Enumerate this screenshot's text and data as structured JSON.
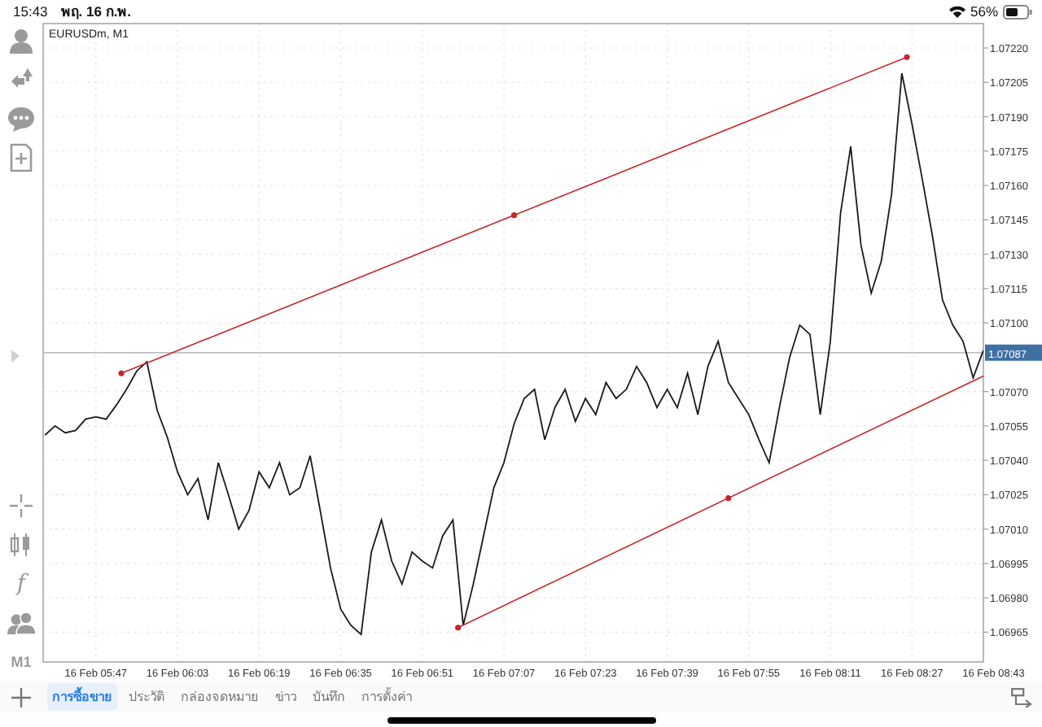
{
  "status_bar": {
    "time": "15:43",
    "date": "พฤ. 16 ก.พ.",
    "battery": "56%"
  },
  "toolbar": {
    "function_glyph": "f",
    "timeframe": "M1"
  },
  "chart": {
    "title": "EURUSDm, M1",
    "chart_data": {
      "type": "line",
      "grid": true,
      "categories": [
        null,
        null,
        null,
        null,
        null,
        "16 Feb 05:47",
        null,
        null,
        null,
        null,
        null,
        null,
        null,
        "16 Feb 06:03",
        null,
        null,
        null,
        null,
        null,
        null,
        null,
        "16 Feb 06:19",
        null,
        null,
        null,
        null,
        null,
        null,
        null,
        "16 Feb 06:35",
        null,
        null,
        null,
        null,
        null,
        null,
        null,
        "16 Feb 06:51",
        null,
        null,
        null,
        null,
        null,
        null,
        null,
        "16 Feb 07:07",
        null,
        null,
        null,
        null,
        null,
        null,
        null,
        "16 Feb 07:23",
        null,
        null,
        null,
        null,
        null,
        null,
        null,
        "16 Feb 07:39",
        null,
        null,
        null,
        null,
        null,
        null,
        null,
        "16 Feb 07:55",
        null,
        null,
        null,
        null,
        null,
        null,
        null,
        "16 Feb 08:11",
        null,
        null,
        null,
        null,
        null,
        null,
        null,
        "16 Feb 08:27",
        null,
        null,
        null,
        null,
        null,
        null,
        null,
        "16 Feb 08:43"
      ],
      "series": [
        {
          "color": "#1a1a1a",
          "values": [
            1.07051,
            1.07055,
            1.07052,
            1.07053,
            1.07058,
            1.07059,
            1.07058,
            1.07064,
            1.07071,
            1.07079,
            1.07083,
            1.07062,
            1.0705,
            1.07035,
            1.07025,
            1.07032,
            1.07014,
            1.07039,
            1.07025,
            1.0701,
            1.07018,
            1.07035,
            1.07028,
            1.07039,
            1.07025,
            1.07028,
            1.07042,
            1.07018,
            1.06993,
            1.06975,
            1.06968,
            1.06964,
            1.07,
            1.07014,
            1.06996,
            1.06986,
            1.07,
            1.06996,
            1.06993,
            1.07007,
            1.07014,
            1.06968,
            1.06986,
            1.07007,
            1.07028,
            1.07039,
            1.07056,
            1.07067,
            1.07071,
            1.07049,
            1.07063,
            1.07071,
            1.07057,
            1.07067,
            1.0706,
            1.07074,
            1.07067,
            1.07071,
            1.07081,
            1.07074,
            1.07063,
            1.07071,
            1.07063,
            1.07078,
            1.0706,
            1.07081,
            1.07092,
            1.07074,
            1.07067,
            1.0706,
            1.07049,
            1.07039,
            1.07063,
            1.07085,
            1.07099,
            1.07095,
            1.0706,
            1.07092,
            1.07148,
            1.07177,
            1.07134,
            1.07113,
            1.07127,
            1.07156,
            1.07209,
            1.07187,
            1.07163,
            1.07138,
            1.0711,
            1.07099,
            1.07092,
            1.07076,
            1.07088,
            null
          ]
        }
      ],
      "ylim": [
        1.06952,
        1.07231
      ],
      "yticks": [
        {
          "value": 1.0722,
          "label": "1.07220"
        },
        {
          "value": 1.07205,
          "label": "1.07205"
        },
        {
          "value": 1.0719,
          "label": "1.07190"
        },
        {
          "value": 1.07175,
          "label": "1.07175"
        },
        {
          "value": 1.0716,
          "label": "1.07160"
        },
        {
          "value": 1.07145,
          "label": "1.07145"
        },
        {
          "value": 1.0713,
          "label": "1.07130"
        },
        {
          "value": 1.07115,
          "label": "1.07115"
        },
        {
          "value": 1.071,
          "label": "1.07100"
        },
        {
          "value": 1.0707,
          "label": "1.07070"
        },
        {
          "value": 1.07055,
          "label": "1.07055"
        },
        {
          "value": 1.0704,
          "label": "1.07040"
        },
        {
          "value": 1.07025,
          "label": "1.07025"
        },
        {
          "value": 1.0701,
          "label": "1.07010"
        },
        {
          "value": 1.06995,
          "label": "1.06995"
        },
        {
          "value": 1.0698,
          "label": "1.06980"
        },
        {
          "value": 1.06965,
          "label": "1.06965"
        }
      ],
      "ref_lines": [
        {
          "axis": "y",
          "value": 1.07087,
          "label": "1.07087"
        }
      ]
    }
  },
  "tabs": [
    {
      "label": "การซื้อขาย",
      "selected": true
    },
    {
      "label": "ประวัติ",
      "selected": false
    },
    {
      "label": "กล่องจดหมาย",
      "selected": false
    },
    {
      "label": "ข่าว",
      "selected": false
    },
    {
      "label": "บันทึก",
      "selected": false
    },
    {
      "label": "การตั้งค่า",
      "selected": false
    }
  ]
}
